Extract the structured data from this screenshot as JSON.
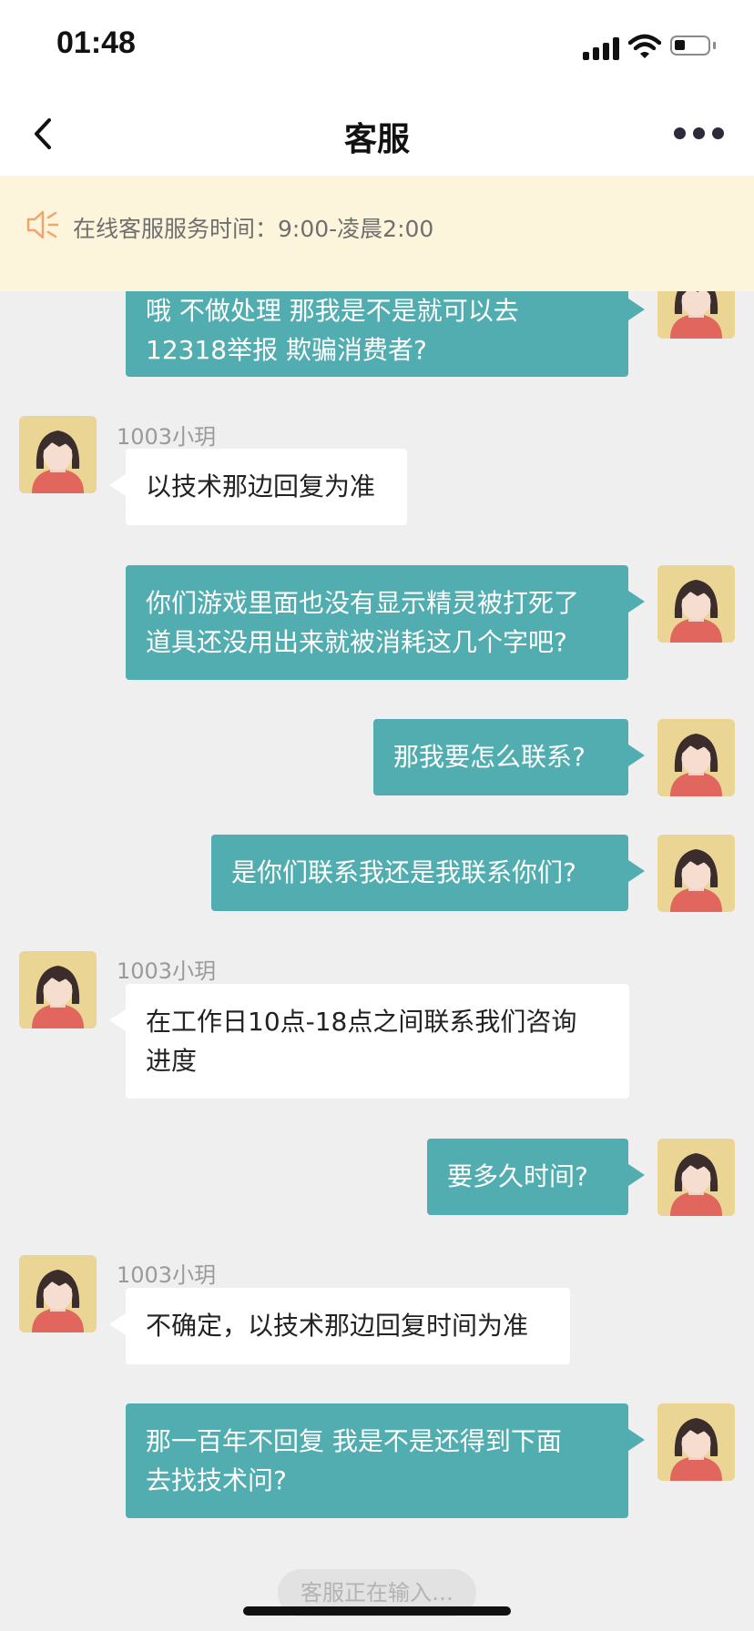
{
  "status": {
    "time": "01:48"
  },
  "nav": {
    "title": "客服"
  },
  "notice": {
    "text": "在线客服服务时间：9:00-凌晨2:00"
  },
  "messages": [
    {
      "side": "me",
      "text": "哦 不做处理 那我是不是就可以去\n12318举报 欺骗消费者?"
    },
    {
      "side": "them",
      "sender": "1003小玥",
      "text": "以技术那边回复为准"
    },
    {
      "side": "me",
      "text": "你们游戏里面也没有显示精灵被打死了\n道具还没用出来就被消耗这几个字吧?"
    },
    {
      "side": "me",
      "text": "那我要怎么联系?"
    },
    {
      "side": "me",
      "text": "是你们联系我还是我联系你们?"
    },
    {
      "side": "them",
      "sender": "1003小玥",
      "text": "在工作日10点-18点之间联系我们咨询\n进度"
    },
    {
      "side": "me",
      "text": "要多久时间?"
    },
    {
      "side": "them",
      "sender": "1003小玥",
      "text": "不确定，以技术那边回复时间为准"
    },
    {
      "side": "me",
      "text": "那一百年不回复 我是不是还得到下面\n去找技术问?"
    }
  ],
  "typing_indicator": "客服正在输入…",
  "colors": {
    "my_bubble": "#52adb0",
    "their_bubble": "#ffffff",
    "background": "#efefef",
    "notice_bg": "#fcf5dc",
    "notice_icon": "#f0a36b"
  }
}
